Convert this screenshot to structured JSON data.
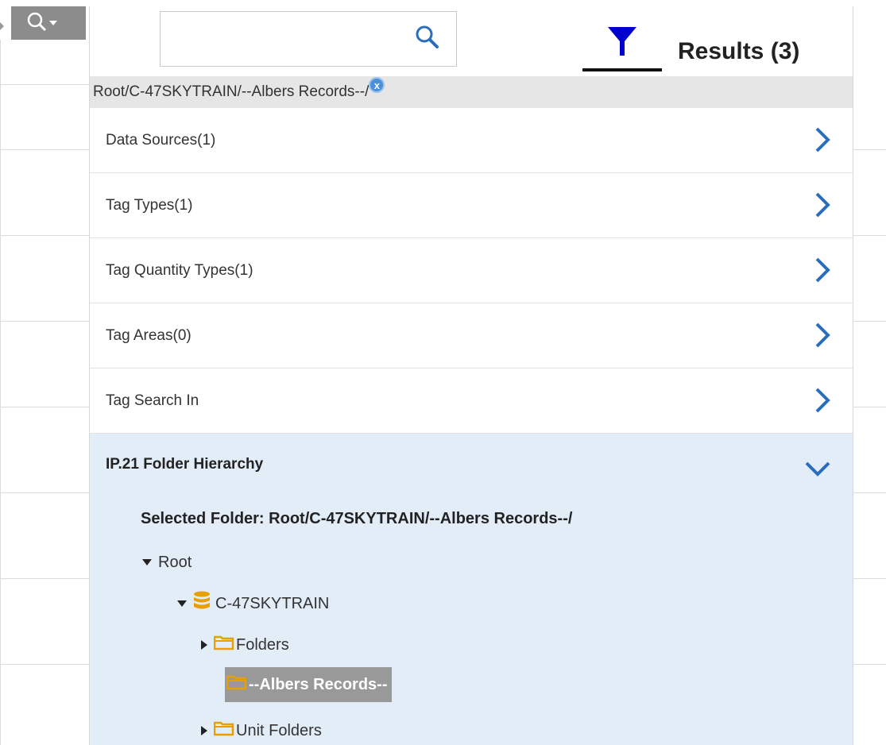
{
  "toolbar": {
    "search_tool_icon": "magnifier-icon",
    "tag_tool_icon": "tag-icon"
  },
  "search": {
    "value": "",
    "placeholder": "",
    "icon": "search-icon"
  },
  "tabs": {
    "filter_icon": "filter-funnel-icon",
    "results_label": "Results (3)"
  },
  "breadcrumb": {
    "path": "Root/C-47SKYTRAIN/--Albers Records--/",
    "clear_icon": "x"
  },
  "categories": [
    {
      "label": "Data Sources(1)"
    },
    {
      "label": "Tag Types(1)"
    },
    {
      "label": "Tag Quantity Types(1)"
    },
    {
      "label": "Tag Areas(0)"
    },
    {
      "label": "Tag Search In"
    }
  ],
  "hierarchy": {
    "title": "IP.21 Folder Hierarchy",
    "selected_folder": "Selected Folder: Root/C-47SKYTRAIN/--Albers Records--/",
    "nodes": [
      {
        "label": "Root",
        "state": "expanded"
      },
      {
        "label": "C-47SKYTRAIN",
        "state": "expanded",
        "icon": "database-icon"
      },
      {
        "label": "Folders",
        "state": "collapsed",
        "icon": "folder-icon"
      },
      {
        "label": "--Albers Records--",
        "state": "selected",
        "icon": "folder-icon"
      },
      {
        "label": "Unit Folders",
        "state": "collapsed",
        "icon": "folder-icon"
      }
    ]
  },
  "colors": {
    "accent_blue": "#2a6ebb",
    "filter_icon": "#0000cc",
    "hierarchy_bg": "#e3edf8",
    "folder_icon": "#e8a000",
    "selected_bg": "#999999"
  }
}
